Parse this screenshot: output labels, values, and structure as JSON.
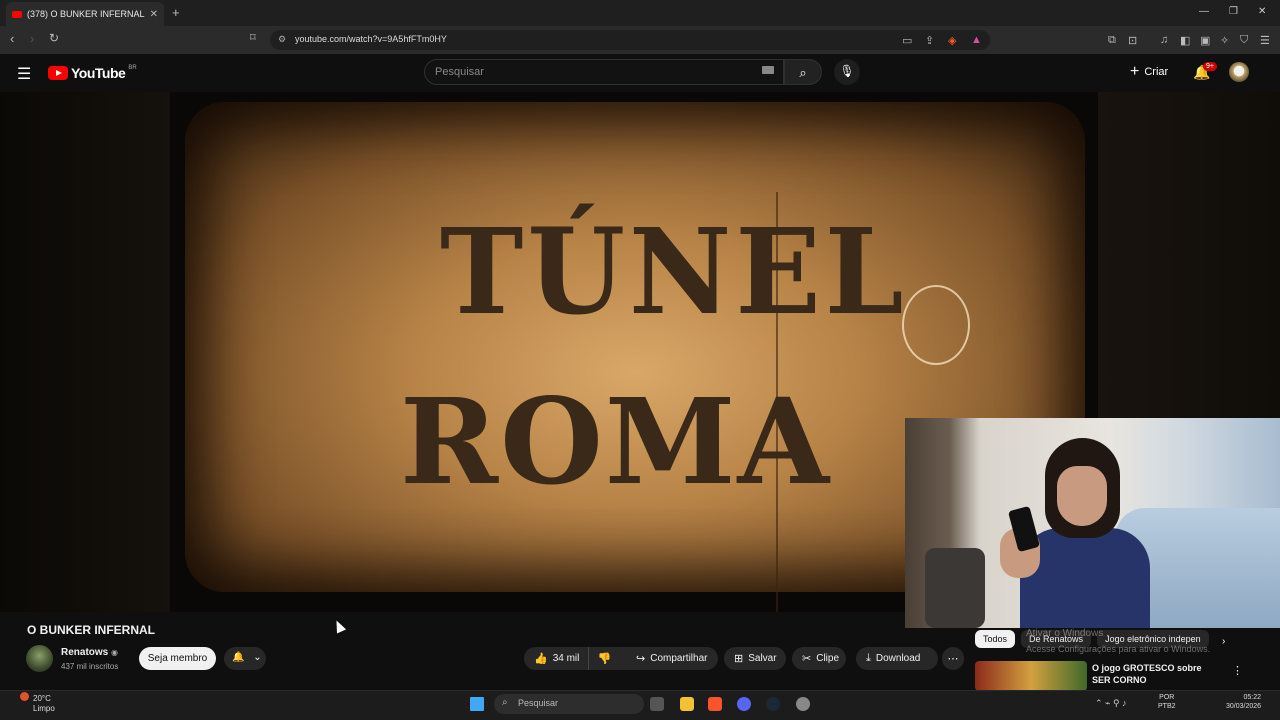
{
  "browser": {
    "tab_title": "(378) O BUNKER INFERNAL -",
    "tab_close": "✕",
    "new_tab": "+",
    "url": "youtube.com/watch?v=9A5hfFTm0HY",
    "window_controls": [
      "—",
      "❐",
      "✕"
    ]
  },
  "youtube": {
    "logo_text": "YouTube",
    "country_code": "BR",
    "search_placeholder": "Pesquisar",
    "create_label": "Criar",
    "notifications_badge": "9+"
  },
  "video": {
    "frame_title_line1": "TÚNEL",
    "frame_title_line2": "ROMA",
    "title": "O BUNKER INFERNAL"
  },
  "channel": {
    "name": "Renatows",
    "subscribers": "437 mil inscritos",
    "member_button": "Seja membro"
  },
  "actions": {
    "likes": "34 mil",
    "share": "Compartilhar",
    "save": "Salvar",
    "clip": "Clipe",
    "download": "Download"
  },
  "recommendations": {
    "chips": [
      "Todos",
      "De Renatows",
      "Jogo eletrônico indepen"
    ],
    "activation_watermark_1": "Ativar o Windows",
    "activation_watermark_2": "Acesse Configurações para ativar o Windows.",
    "first_video_title": "O jogo GROTESCO sobre SER CORNO"
  },
  "taskbar": {
    "weather_temp": "20°C",
    "weather_desc": "Limpo",
    "search_placeholder": "Pesquisar",
    "lang_1": "POR",
    "lang_2": "PTB2",
    "time": "05:22",
    "date": "30/03/2026"
  }
}
